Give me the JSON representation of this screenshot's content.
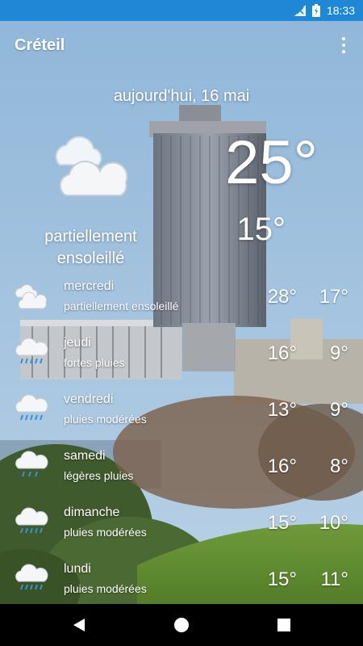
{
  "status_bar": {
    "time": "18:33",
    "icons": [
      "signal-off-icon",
      "battery-charging-icon"
    ],
    "color": "#1e88d6"
  },
  "toolbar": {
    "city": "Créteil",
    "menu_icon": "more-vert-icon"
  },
  "today": {
    "date": "aujourd'hui, 16 mai",
    "high": "25°",
    "low": "15°",
    "condition": "partiellement ensoleillé",
    "icon": "partly-cloudy-icon"
  },
  "forecast": [
    {
      "day": "mercredi",
      "desc": "partiellement ensoleillé",
      "hi": "28°",
      "lo": "17°",
      "icon": "partly-cloudy-icon"
    },
    {
      "day": "jeudi",
      "desc": "fortes pluies",
      "hi": "16°",
      "lo": "9°",
      "icon": "rain-icon"
    },
    {
      "day": "vendredi",
      "desc": "pluies modérées",
      "hi": "13°",
      "lo": "9°",
      "icon": "rain-icon"
    },
    {
      "day": "samedi",
      "desc": "légères pluies",
      "hi": "16°",
      "lo": "8°",
      "icon": "rain-icon"
    },
    {
      "day": "dimanche",
      "desc": "pluies modérées",
      "hi": "15°",
      "lo": "10°",
      "icon": "rain-icon"
    },
    {
      "day": "lundi",
      "desc": "pluies modérées",
      "hi": "15°",
      "lo": "11°",
      "icon": "rain-icon"
    }
  ],
  "nav_bar": {
    "icons": [
      "back-icon",
      "home-icon",
      "recents-icon"
    ]
  }
}
